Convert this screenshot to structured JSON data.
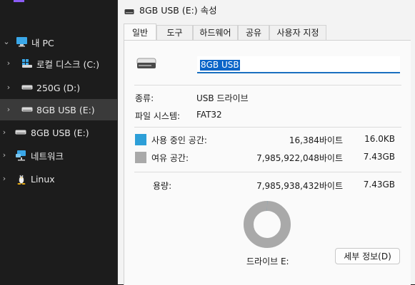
{
  "sidebar": {
    "items": [
      {
        "label": "내 PC",
        "icon": "monitor-icon",
        "expanded": true
      },
      {
        "label": "로컬 디스크 (C:)",
        "icon": "windows-drive-icon",
        "expanded": false
      },
      {
        "label": "250G (D:)",
        "icon": "drive-icon",
        "expanded": false
      },
      {
        "label": "8GB USB (E:)",
        "icon": "drive-icon",
        "expanded": false,
        "selected": true
      },
      {
        "label": "8GB USB (E:)",
        "icon": "drive-icon",
        "expanded": false
      },
      {
        "label": "네트워크",
        "icon": "network-icon",
        "expanded": false
      },
      {
        "label": "Linux",
        "icon": "linux-penguin-icon",
        "expanded": false
      }
    ]
  },
  "dialog": {
    "title": "8GB USB (E:) 속성",
    "tabs": [
      {
        "label": "일반",
        "active": true
      },
      {
        "label": "도구"
      },
      {
        "label": "하드웨어"
      },
      {
        "label": "공유"
      },
      {
        "label": "사용자 지정"
      }
    ],
    "name_value": "8GB USB",
    "type_label": "종류:",
    "type_value": "USB 드라이브",
    "fs_label": "파일 시스템:",
    "fs_value": "FAT32",
    "used": {
      "label": "사용 중인 공간:",
      "bytes": "16,384바이트",
      "size": "16.0KB",
      "color": "#2d9fd8"
    },
    "free": {
      "label": "여유 공간:",
      "bytes": "7,985,922,048바이트",
      "size": "7.43GB",
      "color": "#a9a9a9"
    },
    "capacity": {
      "label": "용량:",
      "bytes": "7,985,938,432바이트",
      "size": "7.43GB"
    },
    "used_fraction": 2e-06,
    "drive_label": "드라이브 E:",
    "details_button": "세부 정보(D)"
  },
  "colors": {
    "accent": "#8b5cf6",
    "selection": "#0a64c8",
    "sidebar_bg": "#1c1c1c"
  }
}
